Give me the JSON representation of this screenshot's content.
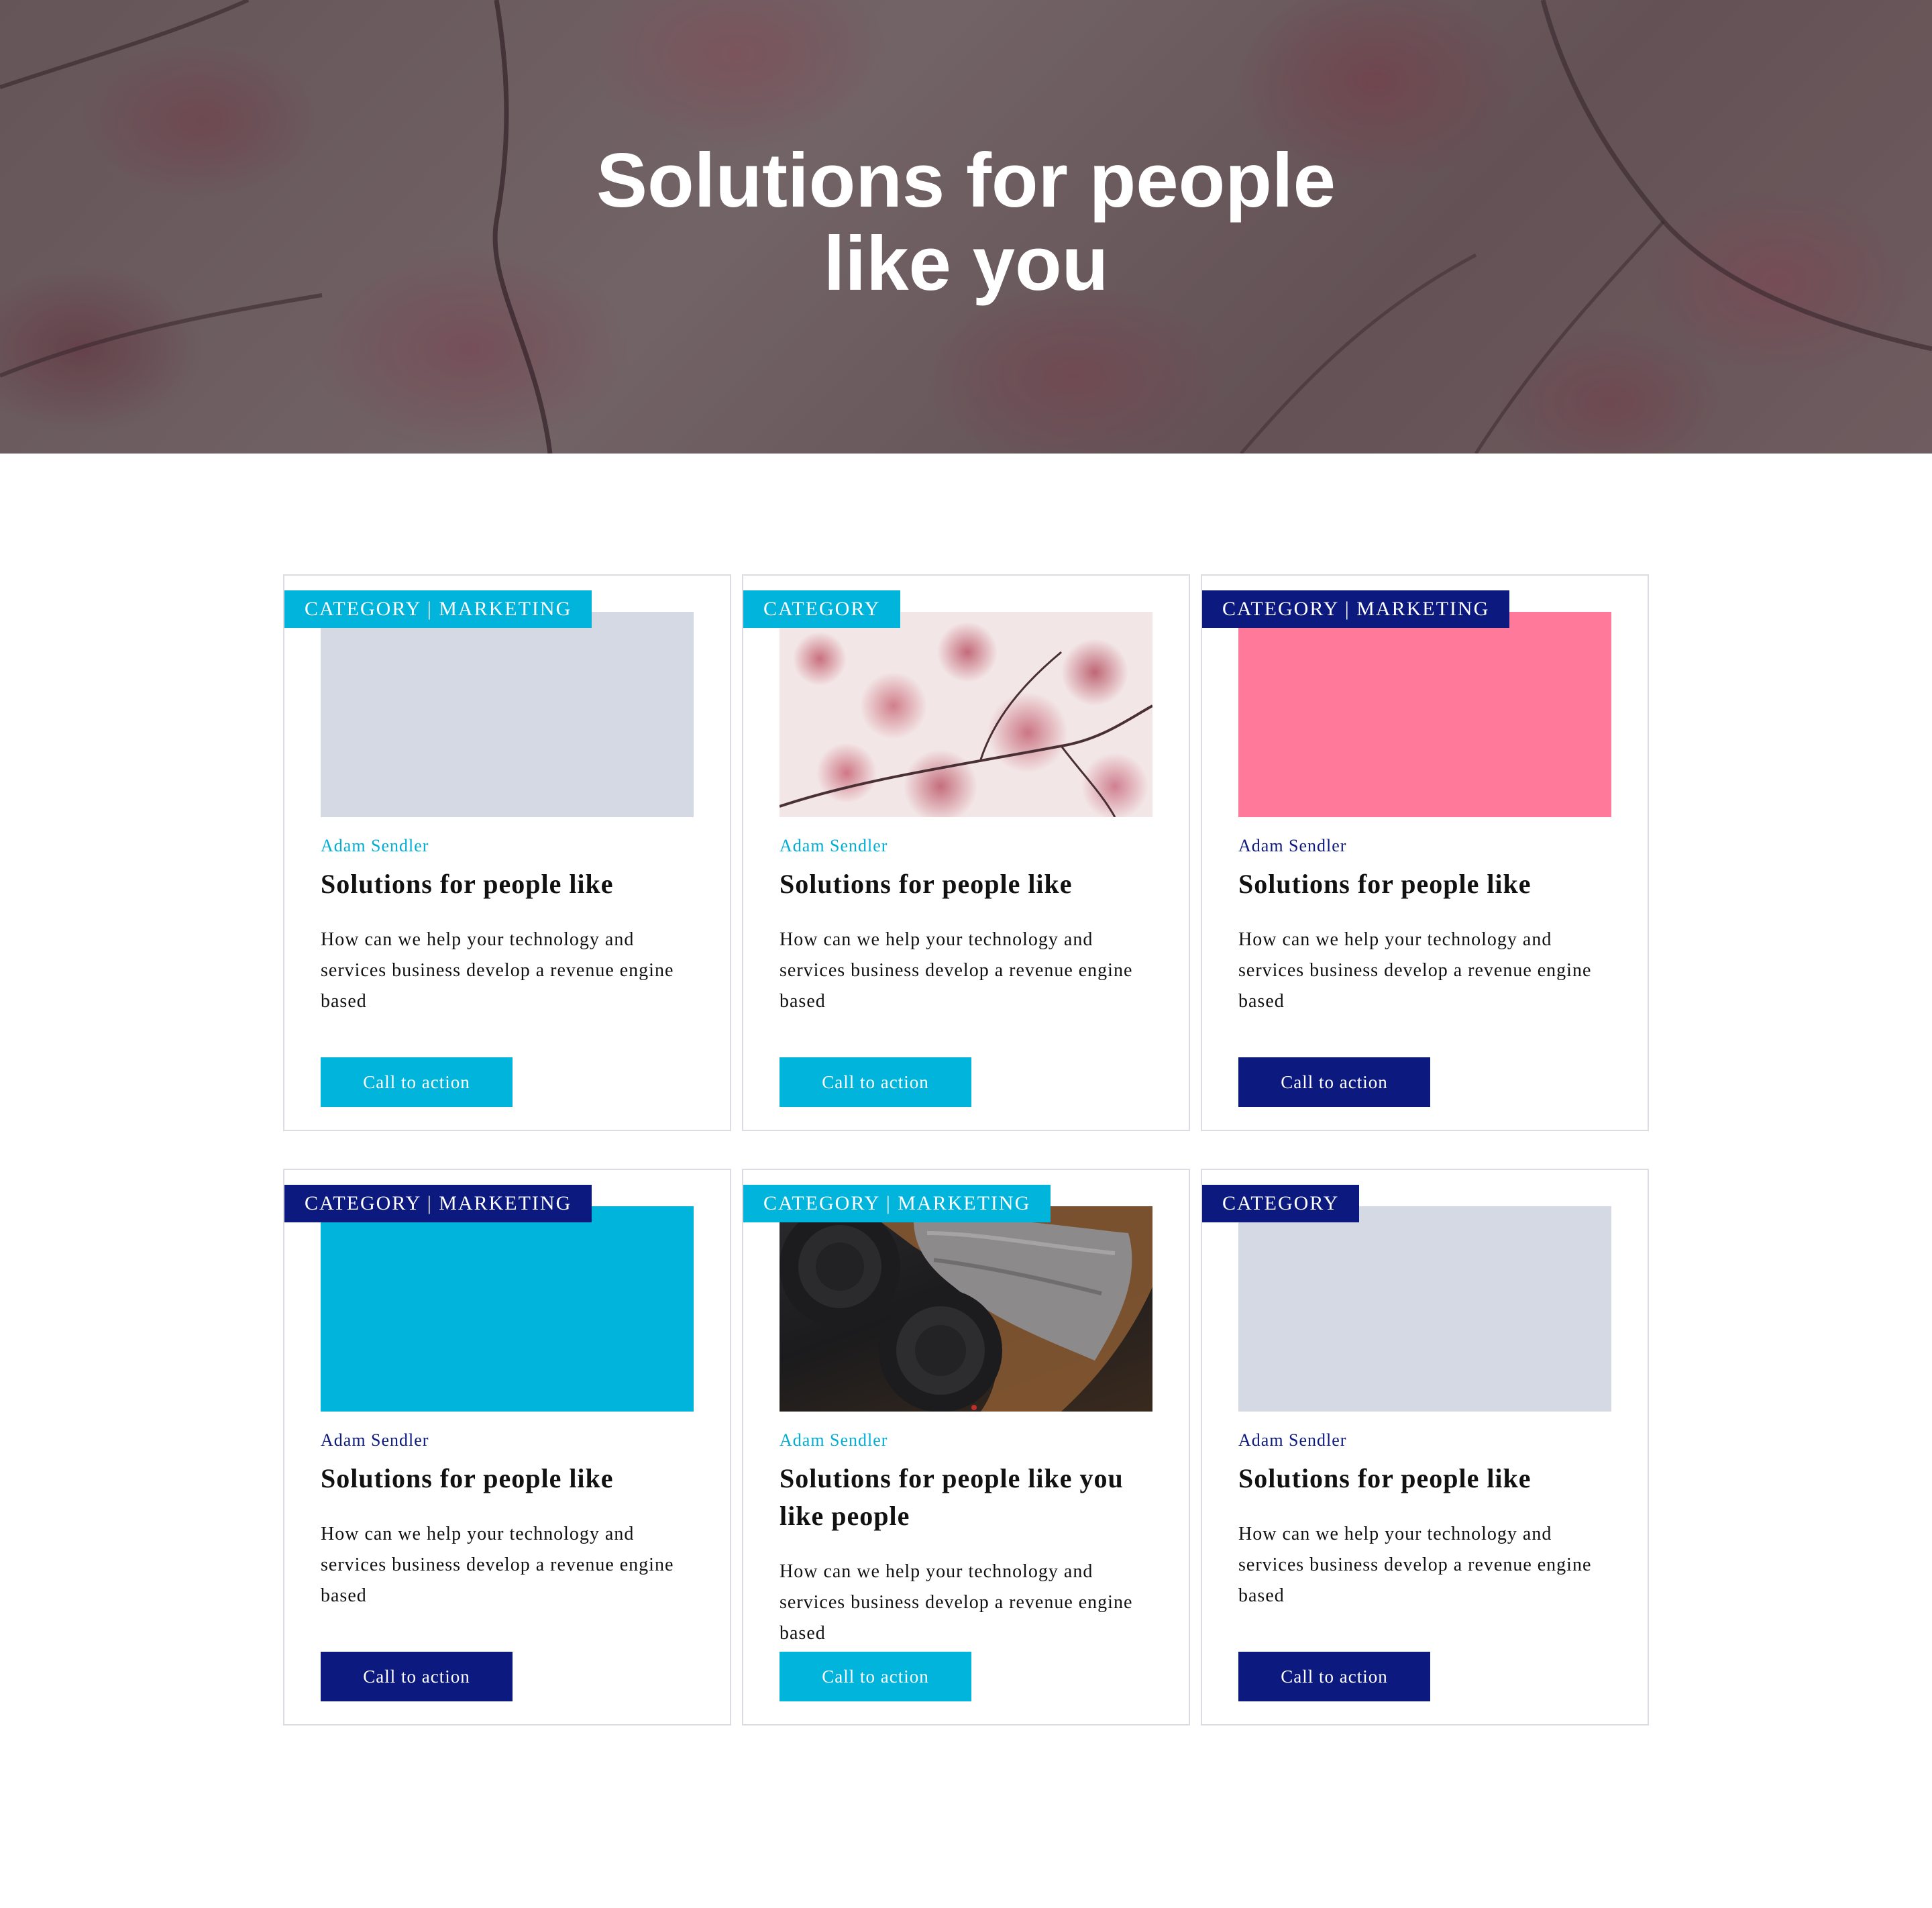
{
  "hero": {
    "title": "Solutions for people like you"
  },
  "colors": {
    "cyan": "#00b4dc",
    "navy": "#0c1a80",
    "placeholder_gray": "#d5d9e4",
    "pink": "#ff7a9a",
    "border": "#dcdde3"
  },
  "cards": [
    {
      "tag": "CATEGORY | MARKETING",
      "accent": "cyan",
      "media": "gray-placeholder",
      "author": "Adam Sendler",
      "title": "Solutions for people like",
      "description": "How can we help your technology and services business develop a revenue engine based",
      "cta": "Call to action"
    },
    {
      "tag": "CATEGORY",
      "accent": "cyan",
      "media": "cherry-blossom-photo",
      "author": "Adam Sendler",
      "title": "Solutions for people like",
      "description": "How can we help your technology and services business develop a revenue engine based",
      "cta": "Call to action"
    },
    {
      "tag": "CATEGORY | MARKETING",
      "accent": "navy",
      "media": "pink-placeholder",
      "author": "Adam Sendler",
      "title": "Solutions for people like",
      "description": "How can we help your technology and services business develop a revenue engine based",
      "cta": "Call to action"
    },
    {
      "tag": "CATEGORY | MARKETING",
      "accent": "navy",
      "media": "cyan-placeholder",
      "author": "Adam Sendler",
      "title": "Solutions for people like",
      "description": "How can we help your technology and services business develop a revenue engine based",
      "cta": "Call to action"
    },
    {
      "tag": "CATEGORY | MARKETING",
      "accent": "cyan",
      "media": "camera-lenses-photo",
      "author": "Adam Sendler",
      "title": "Solutions for people like you like people",
      "description": "How can we help your technology and services business develop a revenue engine based",
      "cta": "Call to action"
    },
    {
      "tag": "CATEGORY",
      "accent": "navy",
      "media": "gray-placeholder",
      "author": "Adam Sendler",
      "title": "Solutions for people like",
      "description": "How can we help your technology and services business develop a revenue engine based",
      "cta": "Call to action"
    }
  ]
}
